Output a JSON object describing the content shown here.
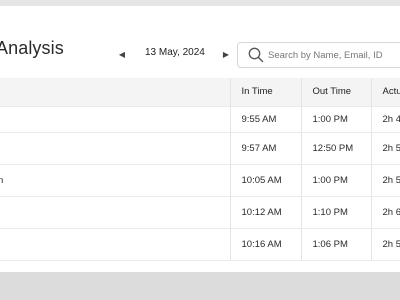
{
  "header": {
    "title": "Analysis",
    "date": "13 May, 2024",
    "prev_icon": "triangle-left",
    "next_icon": "triangle-right"
  },
  "search": {
    "placeholder": "Search by Name, Email, ID",
    "icon": "search"
  },
  "table": {
    "columns": [
      "",
      "In Time",
      "Out Time",
      "Actu"
    ],
    "rows": [
      {
        "name": "",
        "in": "9:55 AM",
        "out": "1:00 PM",
        "actual": "2h 4"
      },
      {
        "name": "",
        "in": "9:57 AM",
        "out": "12:50 PM",
        "actual": "2h 5"
      },
      {
        "name": "n",
        "in": "10:05 AM",
        "out": "1:00 PM",
        "actual": "2h 5"
      },
      {
        "name": "",
        "in": "10:12 AM",
        "out": "1:10 PM",
        "actual": "2h 6"
      },
      {
        "name": "",
        "in": "10:16 AM",
        "out": "1:06 PM",
        "actual": "2h 5"
      }
    ]
  },
  "colors": {
    "header_bg": "#f4f4f4",
    "border": "#e4e4e4",
    "background": "#e9e9e9"
  }
}
